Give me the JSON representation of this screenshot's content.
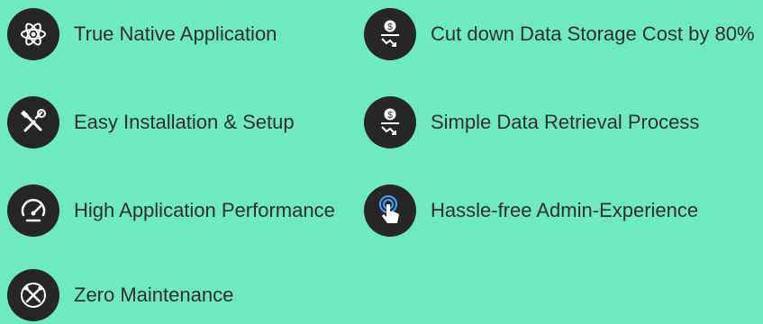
{
  "features": [
    {
      "label": "True Native Application",
      "icon": "atom-icon"
    },
    {
      "label": "Cut down Data Storage Cost by 80%",
      "icon": "storage-cost-icon"
    },
    {
      "label": "Easy Installation & Setup",
      "icon": "tools-icon"
    },
    {
      "label": "Simple Data Retrieval Process",
      "icon": "data-retrieval-icon"
    },
    {
      "label": "High Application Performance",
      "icon": "speedometer-icon"
    },
    {
      "label": "Hassle-free Admin-Experience",
      "icon": "touch-icon"
    },
    {
      "label": "Zero Maintenance",
      "icon": "maintenance-icon"
    }
  ],
  "colors": {
    "background": "#6fe9bf",
    "icon_circle": "#262626",
    "text": "#2f2f2f",
    "icon_glyph": "#ffffff",
    "touch_accent": "#4aa3ff"
  }
}
